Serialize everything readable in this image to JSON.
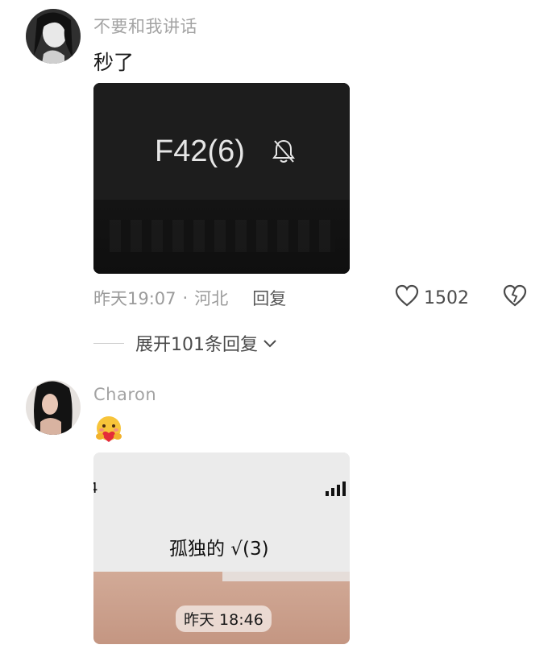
{
  "comments": [
    {
      "username": "不要和我讲话",
      "text": "秒了",
      "image": {
        "title": "F42(6)",
        "bell_icon": "bell-muted-icon"
      },
      "meta": {
        "time": "昨天19:07",
        "separator": "·",
        "location": "河北",
        "reply_label": "回复"
      },
      "likes": "1502",
      "expand_label": "展开101条回复"
    },
    {
      "username": "Charon",
      "emoji": "hug-heart-emoji",
      "image": {
        "title": "孤独的 √(3)",
        "timestamp": "昨天 18:46",
        "left_edge_char": "4"
      }
    }
  ],
  "colors": {
    "username": "#a3a3a3",
    "meta": "#9b9b9b",
    "dark_card": "#181818",
    "emoji": "#f7c43a"
  }
}
